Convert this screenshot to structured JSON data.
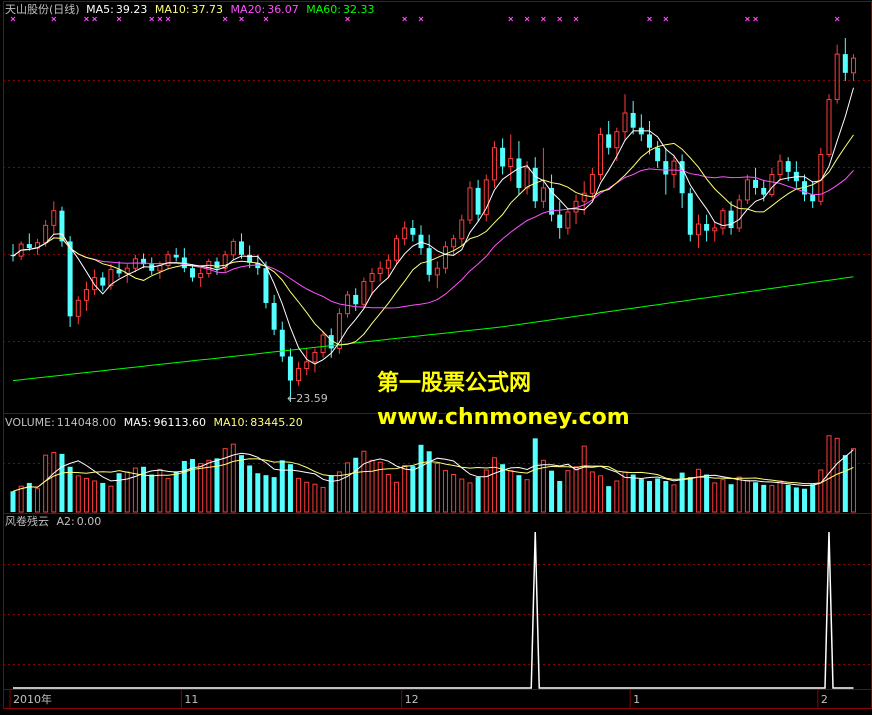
{
  "header": {
    "stock_name": "天山股份(日线)",
    "ma5_label": "MA5:",
    "ma5_value": "39.23",
    "ma10_label": "MA10:",
    "ma10_value": "37.73",
    "ma20_label": "MA20:",
    "ma20_value": "36.07",
    "ma60_label": "MA60:",
    "ma60_value": "32.33"
  },
  "volume_header": {
    "label": "VOLUME:",
    "value": "114048.00",
    "ma5_label": "MA5:",
    "ma5_value": "96113.60",
    "ma10_label": "MA10:",
    "ma10_value": "83445.20"
  },
  "indicator_header": {
    "name": "风卷残云",
    "a2_label": "A2:",
    "a2_value": "0.00"
  },
  "watermark": {
    "line1": "第一股票公式网",
    "line2": "www.chnmoney.com"
  },
  "annotation": {
    "low_marker": "←23.59"
  },
  "date_axis": [
    {
      "label": "2010年",
      "index": 0
    },
    {
      "label": "11",
      "index": 21
    },
    {
      "label": "12",
      "index": 48
    },
    {
      "label": "1",
      "index": 76
    },
    {
      "label": "2",
      "index": 99
    }
  ],
  "colors": {
    "background": "#000000",
    "up": "#ff3c3c",
    "down": "#54ffff",
    "ma5": "#ffffff",
    "ma10": "#ffff78",
    "ma20": "#ff50ff",
    "ma60": "#00ff00",
    "grid": "#8b0000",
    "text": "#c0c0c0",
    "marker": "#ff50ff"
  },
  "chart_data": {
    "type": "candlestick",
    "price_ylim": [
      23,
      52
    ],
    "candles": [
      [
        34.6,
        35.4,
        34.1,
        34.5
      ],
      [
        34.5,
        35.6,
        34.2,
        35.4
      ],
      [
        35.4,
        36.2,
        34.9,
        35.1
      ],
      [
        35.1,
        35.8,
        34.6,
        35.5
      ],
      [
        35.5,
        37.2,
        35.2,
        36.8
      ],
      [
        36.8,
        38.6,
        36.1,
        37.9
      ],
      [
        37.9,
        38.2,
        35.2,
        35.6
      ],
      [
        35.6,
        36.0,
        29.2,
        30.0
      ],
      [
        30.0,
        31.5,
        29.4,
        31.2
      ],
      [
        31.2,
        32.6,
        30.4,
        32.0
      ],
      [
        32.0,
        33.5,
        31.6,
        32.9
      ],
      [
        32.9,
        33.3,
        31.9,
        32.3
      ],
      [
        32.3,
        33.9,
        32.0,
        33.5
      ],
      [
        33.5,
        34.1,
        32.9,
        33.2
      ],
      [
        33.2,
        33.9,
        32.5,
        33.6
      ],
      [
        33.6,
        34.6,
        33.3,
        34.3
      ],
      [
        34.3,
        34.7,
        33.6,
        33.9
      ],
      [
        33.9,
        34.4,
        33.1,
        33.4
      ],
      [
        33.4,
        34.1,
        32.8,
        33.8
      ],
      [
        33.8,
        34.9,
        33.5,
        34.6
      ],
      [
        34.6,
        35.1,
        34.1,
        34.4
      ],
      [
        34.4,
        35.1,
        33.3,
        33.6
      ],
      [
        33.6,
        33.9,
        32.6,
        32.9
      ],
      [
        32.9,
        33.6,
        32.2,
        33.2
      ],
      [
        33.2,
        34.3,
        32.9,
        34.1
      ],
      [
        34.1,
        34.4,
        33.1,
        33.6
      ],
      [
        33.6,
        34.9,
        33.3,
        34.6
      ],
      [
        34.6,
        35.8,
        34.2,
        35.6
      ],
      [
        35.6,
        36.2,
        34.3,
        34.6
      ],
      [
        34.6,
        35.3,
        33.6,
        34.0
      ],
      [
        34.0,
        34.6,
        33.1,
        33.6
      ],
      [
        33.6,
        34.1,
        30.6,
        31.0
      ],
      [
        31.0,
        31.6,
        28.6,
        29.0
      ],
      [
        29.0,
        29.6,
        26.6,
        27.0
      ],
      [
        27.0,
        27.6,
        23.6,
        25.2
      ],
      [
        25.2,
        26.6,
        24.8,
        26.1
      ],
      [
        26.1,
        27.6,
        25.6,
        26.6
      ],
      [
        26.6,
        27.6,
        25.8,
        27.3
      ],
      [
        27.3,
        28.9,
        26.9,
        28.6
      ],
      [
        28.6,
        29.1,
        26.9,
        27.6
      ],
      [
        27.6,
        30.6,
        27.2,
        30.2
      ],
      [
        30.2,
        31.9,
        29.9,
        31.6
      ],
      [
        31.6,
        32.1,
        30.4,
        30.9
      ],
      [
        30.9,
        32.9,
        30.6,
        32.6
      ],
      [
        32.6,
        33.6,
        31.6,
        33.2
      ],
      [
        33.2,
        34.1,
        32.6,
        33.6
      ],
      [
        33.6,
        34.6,
        32.9,
        34.2
      ],
      [
        34.2,
        36.1,
        33.9,
        35.8
      ],
      [
        35.8,
        37.1,
        35.3,
        36.6
      ],
      [
        36.6,
        37.2,
        35.6,
        36.1
      ],
      [
        36.1,
        36.8,
        34.6,
        35.1
      ],
      [
        35.1,
        36.1,
        32.6,
        33.1
      ],
      [
        33.1,
        34.1,
        32.1,
        33.6
      ],
      [
        33.6,
        35.6,
        33.2,
        35.2
      ],
      [
        35.2,
        36.1,
        34.6,
        35.8
      ],
      [
        35.8,
        37.6,
        35.3,
        37.2
      ],
      [
        37.2,
        40.1,
        36.9,
        39.6
      ],
      [
        39.6,
        40.2,
        37.1,
        37.6
      ],
      [
        37.6,
        40.6,
        37.1,
        40.2
      ],
      [
        40.2,
        43.1,
        39.6,
        42.6
      ],
      [
        42.6,
        43.3,
        40.6,
        41.2
      ],
      [
        41.2,
        43.6,
        40.1,
        41.8
      ],
      [
        41.8,
        43.1,
        39.1,
        39.6
      ],
      [
        39.6,
        41.6,
        39.1,
        41.1
      ],
      [
        41.1,
        41.9,
        38.1,
        38.6
      ],
      [
        38.6,
        42.6,
        38.1,
        39.6
      ],
      [
        39.6,
        40.6,
        37.1,
        37.6
      ],
      [
        37.6,
        38.6,
        35.8,
        36.6
      ],
      [
        36.6,
        38.1,
        36.1,
        37.8
      ],
      [
        37.8,
        39.1,
        36.9,
        38.6
      ],
      [
        38.6,
        40.1,
        37.6,
        39.2
      ],
      [
        39.2,
        41.1,
        38.6,
        40.6
      ],
      [
        40.6,
        44.1,
        40.2,
        43.6
      ],
      [
        43.6,
        44.6,
        42.1,
        42.6
      ],
      [
        42.6,
        44.1,
        41.6,
        43.8
      ],
      [
        43.8,
        46.6,
        43.1,
        45.2
      ],
      [
        45.2,
        46.1,
        43.6,
        44.1
      ],
      [
        44.1,
        45.1,
        43.1,
        43.6
      ],
      [
        43.6,
        44.6,
        42.1,
        42.6
      ],
      [
        42.6,
        43.1,
        41.1,
        41.6
      ],
      [
        41.6,
        42.6,
        39.1,
        40.6
      ],
      [
        40.6,
        42.1,
        39.6,
        41.6
      ],
      [
        41.6,
        42.1,
        38.1,
        39.2
      ],
      [
        39.2,
        39.6,
        35.6,
        36.1
      ],
      [
        36.1,
        37.6,
        35.1,
        36.9
      ],
      [
        36.9,
        37.6,
        35.6,
        36.4
      ],
      [
        36.4,
        37.1,
        35.6,
        36.6
      ],
      [
        36.6,
        38.1,
        36.1,
        37.9
      ],
      [
        37.9,
        38.6,
        36.1,
        36.6
      ],
      [
        36.6,
        39.1,
        36.3,
        38.7
      ],
      [
        38.7,
        40.6,
        38.4,
        40.2
      ],
      [
        40.2,
        41.1,
        39.1,
        39.6
      ],
      [
        39.6,
        40.2,
        38.6,
        39.1
      ],
      [
        39.1,
        41.1,
        38.9,
        40.6
      ],
      [
        40.6,
        42.1,
        40.1,
        41.6
      ],
      [
        41.6,
        41.9,
        40.1,
        40.8
      ],
      [
        40.8,
        41.6,
        39.6,
        40.1
      ],
      [
        40.1,
        40.6,
        38.6,
        39.1
      ],
      [
        39.1,
        40.1,
        38.1,
        38.6
      ],
      [
        38.6,
        42.6,
        38.3,
        42.1
      ],
      [
        42.1,
        46.6,
        41.9,
        46.2
      ],
      [
        46.2,
        50.3,
        45.9,
        49.6
      ],
      [
        49.6,
        50.8,
        47.6,
        48.2
      ],
      [
        48.2,
        49.6,
        47.6,
        49.3
      ]
    ],
    "volume_ylim": [
      0,
      130000
    ],
    "volume": [
      32000,
      40000,
      45000,
      36000,
      88000,
      92000,
      90000,
      70000,
      56000,
      52000,
      48000,
      45000,
      40000,
      60000,
      62000,
      68000,
      70000,
      58000,
      66000,
      52000,
      63000,
      79000,
      82000,
      75000,
      80000,
      83000,
      98000,
      105000,
      88000,
      72000,
      60000,
      57000,
      54000,
      80000,
      74000,
      52000,
      46000,
      43000,
      38000,
      57000,
      62000,
      76000,
      84000,
      94000,
      80000,
      77000,
      58000,
      46000,
      72000,
      71000,
      104000,
      94000,
      75000,
      64000,
      58000,
      51000,
      45000,
      54000,
      65000,
      84000,
      74000,
      64000,
      57000,
      50000,
      114000,
      80000,
      64000,
      48000,
      64000,
      70000,
      102000,
      62000,
      56000,
      40000,
      48000,
      62000,
      58000,
      51000,
      48000,
      52000,
      48000,
      42000,
      61000,
      54000,
      66000,
      58000,
      45000,
      50000,
      43000,
      54000,
      49000,
      46000,
      42000,
      41000,
      48000,
      42000,
      38000,
      36000,
      43000,
      65000,
      118000,
      114000,
      88000,
      98000
    ],
    "a2_ylim": [
      0,
      1
    ],
    "a2_spikes": [
      64,
      100
    ],
    "marker_row_indices": [
      0,
      5,
      9,
      10,
      13,
      17,
      18,
      19,
      26,
      28,
      31,
      41,
      48,
      50,
      61,
      63,
      65,
      67,
      69,
      78,
      80,
      90,
      91,
      101
    ],
    "low_annotation_index": 34
  }
}
